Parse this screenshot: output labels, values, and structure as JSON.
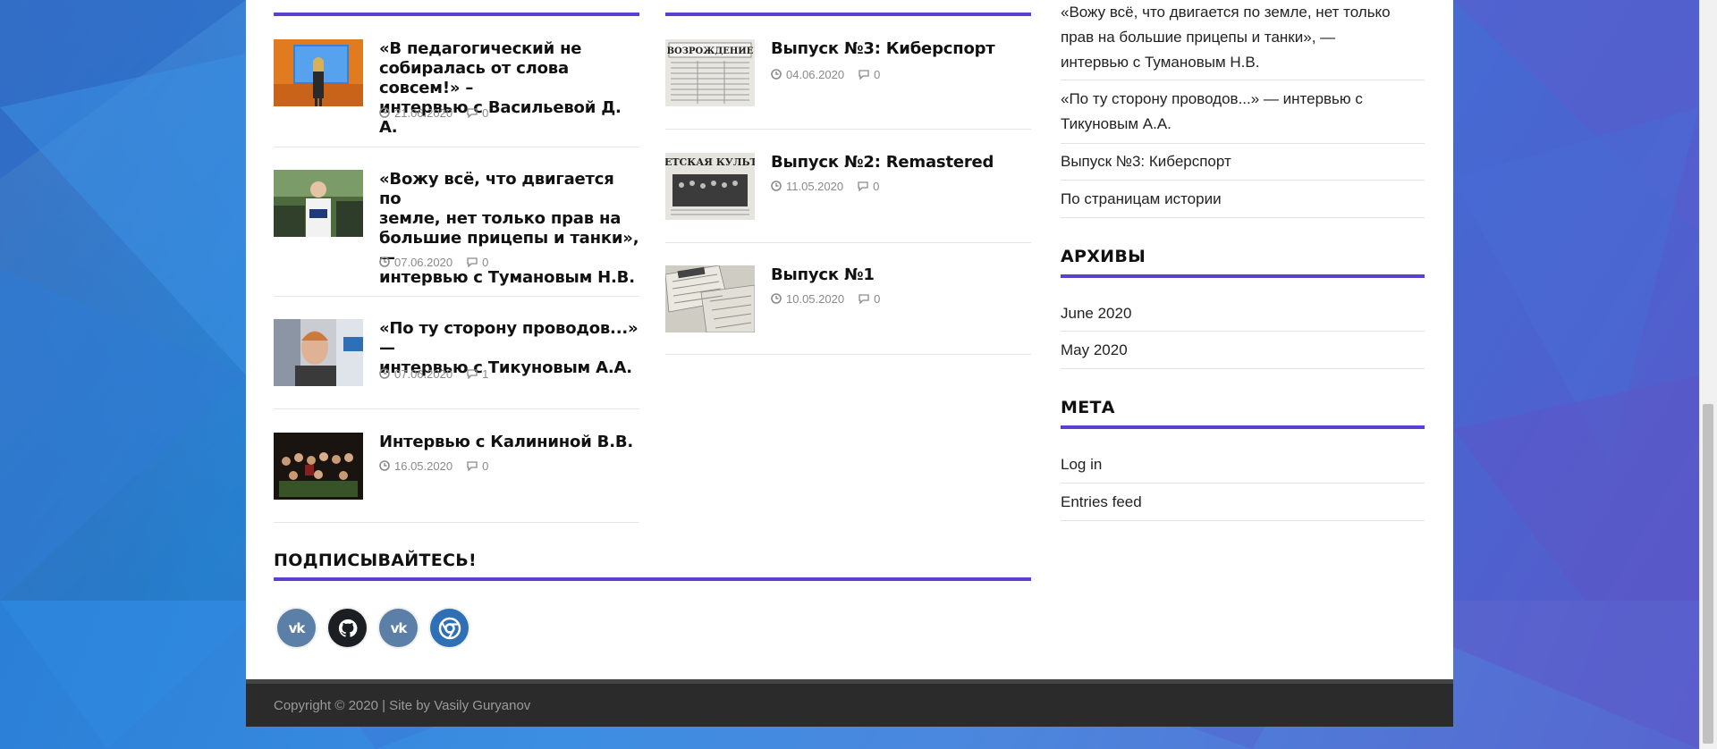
{
  "colors": {
    "accent": "#5b3fcf",
    "footer_bg": "#2b2b2b",
    "page_bg": "#ffffff",
    "vk": "#5b7fa6",
    "github": "#1b1f23",
    "chrome": "#2f6fb5"
  },
  "column1": {
    "posts": [
      {
        "title_lines": [
          "«В педагогический не",
          "собиралась от слова совсем!» –",
          "интервью с Васильевой Д. А."
        ],
        "date": "21.06.2020",
        "comments": "0",
        "thumb": "woman-at-screen-thumbnail"
      },
      {
        "title_lines": [
          "«Вожу всё, что двигается по",
          "земле, нет только прав на",
          "большие прицепы и танки», —",
          "интервью с Тумановым Н.В."
        ],
        "date": "07.06.2020",
        "comments": "0",
        "thumb": "man-outdoors-thumbnail"
      },
      {
        "title_lines": [
          "«По ту сторону проводов...» —",
          "интервью с Тикуновым А.А."
        ],
        "date": "07.06.2020",
        "comments": "1",
        "thumb": "man-portrait-thumbnail"
      },
      {
        "title_lines": [
          "Интервью с Калининой В.В."
        ],
        "date": "16.05.2020",
        "comments": "0",
        "thumb": "group-photo-thumbnail"
      }
    ]
  },
  "column2": {
    "posts": [
      {
        "title_lines": [
          "Выпуск №3: Киберспорт"
        ],
        "date": "04.06.2020",
        "comments": "0",
        "thumb": "newspaper-vozrozhdenie-thumbnail",
        "thumb_text": "ВОЗРОЖДЕНИЕ"
      },
      {
        "title_lines": [
          "Выпуск №2: Remastered"
        ],
        "date": "11.05.2020",
        "comments": "0",
        "thumb": "newspaper-sovetskaya-kultura-thumbnail",
        "thumb_text": "ОВЕТСКАЯ КУЛЬТУР"
      },
      {
        "title_lines": [
          "Выпуск №1"
        ],
        "date": "10.05.2020",
        "comments": "0",
        "thumb": "newspapers-pile-thumbnail",
        "thumb_text": ""
      }
    ]
  },
  "subscribe": {
    "title": "ПОДПИСЫВАЙТЕСЬ!",
    "icons": [
      {
        "name": "vk-icon",
        "glyph": "vk"
      },
      {
        "name": "github-icon",
        "glyph": ""
      },
      {
        "name": "vk-icon",
        "glyph": "vk"
      },
      {
        "name": "chrome-icon",
        "glyph": ""
      }
    ]
  },
  "sidebar": {
    "recent_posts": [
      {
        "lines": [
          "«Вожу всё, что двигается по земле, нет только",
          "прав на большие прицепы и танки», —",
          "интервью с Тумановым Н.В."
        ]
      },
      {
        "lines": [
          "«По ту сторону проводов...» — интервью с",
          "Тикуновым А.А."
        ]
      },
      {
        "lines": [
          "Выпуск №3: Киберспорт"
        ]
      },
      {
        "lines": [
          "По страницам истории"
        ]
      }
    ],
    "archives_title": "АРХИВЫ",
    "archives": [
      "June 2020",
      "May 2020"
    ],
    "meta_title": "МЕТА",
    "meta": [
      "Log in",
      "Entries feed"
    ]
  },
  "footer": {
    "copyright": "Copyright © 2020 | Site by Vasily Guryanov"
  }
}
